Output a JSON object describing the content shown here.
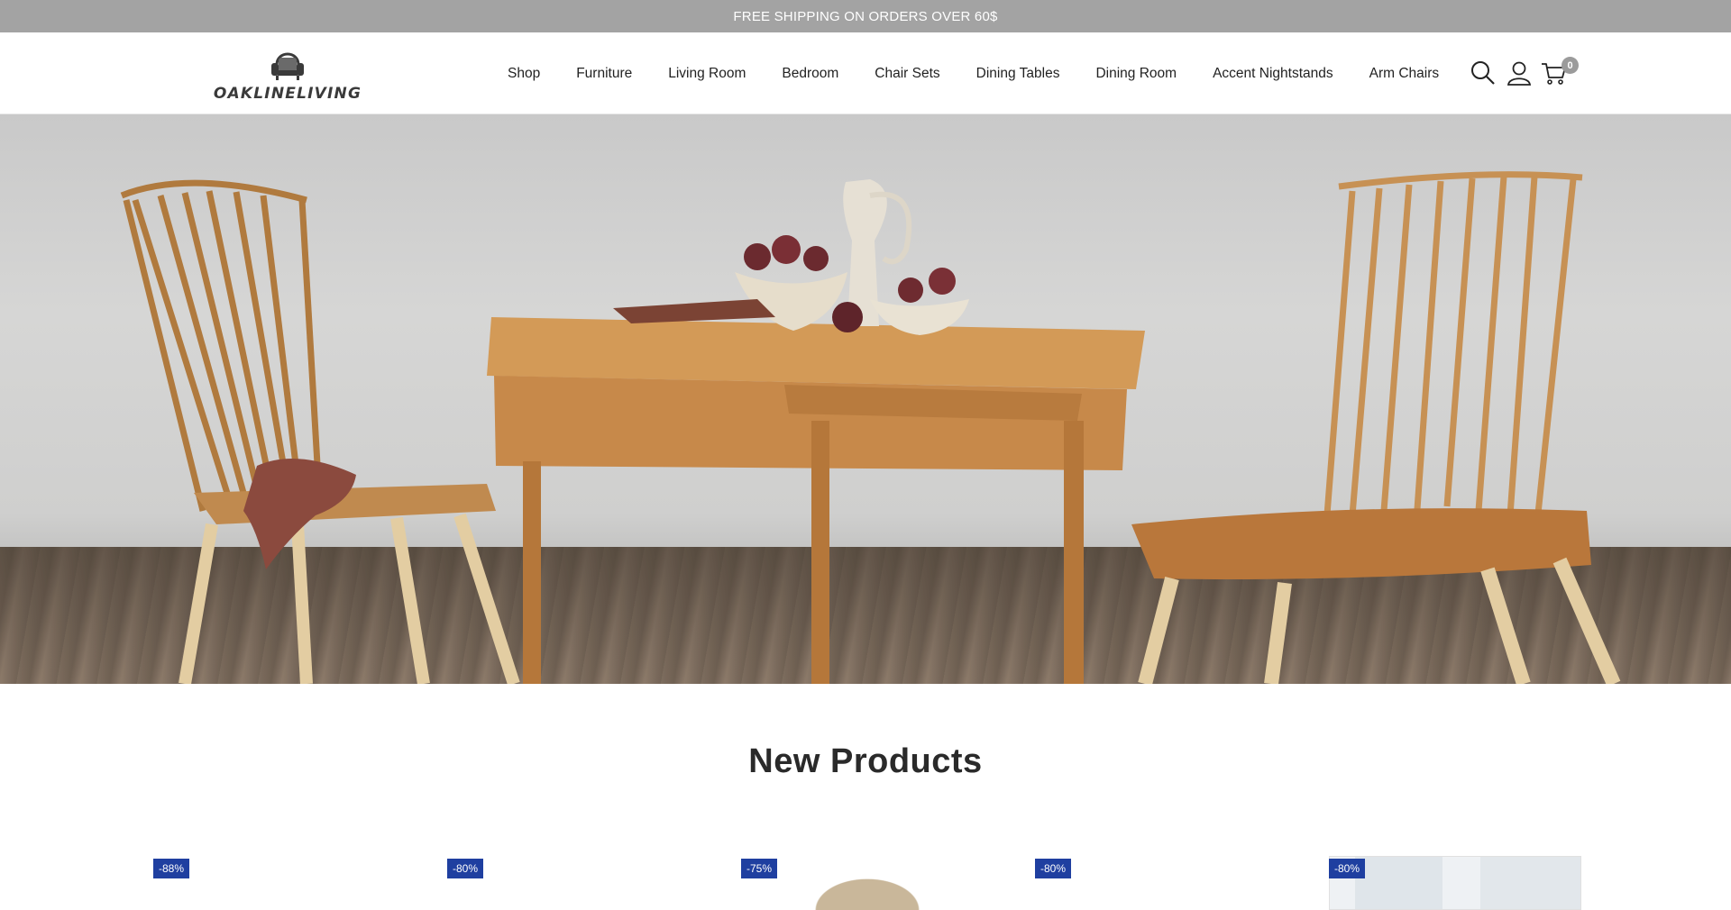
{
  "announcement": "FREE SHIPPING ON ORDERS OVER 60$",
  "brand": {
    "name": "OAKLINELIVING"
  },
  "nav": {
    "items": [
      {
        "label": "Shop"
      },
      {
        "label": "Furniture"
      },
      {
        "label": "Living Room"
      },
      {
        "label": "Bedroom"
      },
      {
        "label": "Chair Sets"
      },
      {
        "label": "Dining Tables"
      },
      {
        "label": "Dining Room"
      },
      {
        "label": "Accent Nightstands"
      },
      {
        "label": "Arm Chairs"
      }
    ]
  },
  "header_icons": {
    "search": "search-icon",
    "account": "user-icon",
    "cart": "cart-icon"
  },
  "cart": {
    "count": "0"
  },
  "section": {
    "title": "New Products"
  },
  "products": [
    {
      "discount": "-88%"
    },
    {
      "discount": "-80%"
    },
    {
      "discount": "-75%"
    },
    {
      "discount": "-80%"
    },
    {
      "discount": "-80%"
    }
  ],
  "colors": {
    "announcement_bg": "#a3a3a3",
    "badge_bg": "#1f3fa0",
    "cart_badge_bg": "#9b9b9b"
  }
}
